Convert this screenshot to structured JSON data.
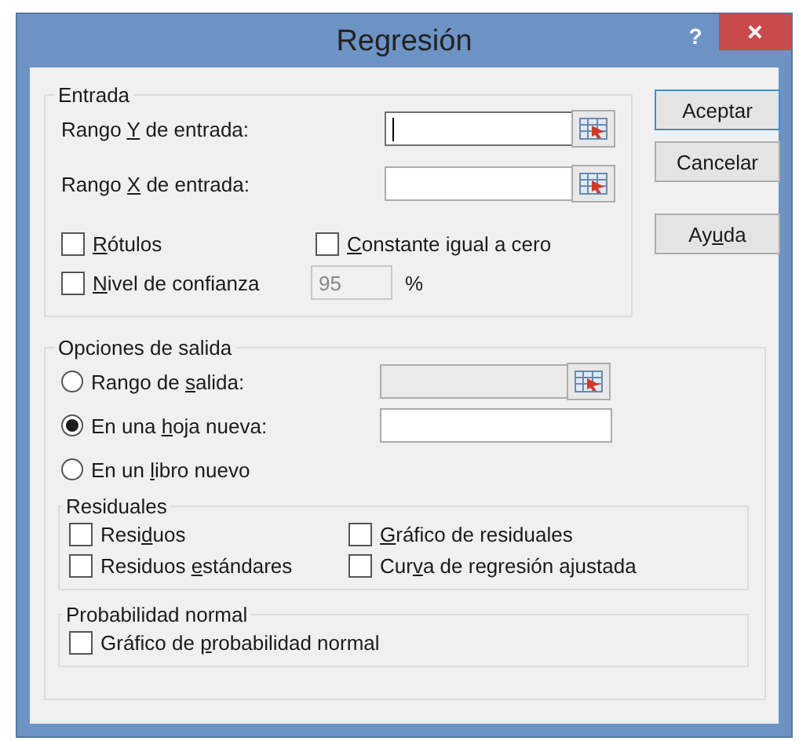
{
  "window": {
    "title": "Regresión",
    "help": "?",
    "close": "×"
  },
  "input": {
    "title": "Entrada",
    "ranges": [
      {
        "label": {
          "pre": "Rango ",
          "key": "Y",
          "post": " de entrada:"
        },
        "focused": true
      },
      {
        "label": {
          "pre": "Rango ",
          "key": "X",
          "post": " de entrada:"
        },
        "focused": false
      }
    ],
    "labels_check": {
      "label": {
        "key": "R",
        "post": "ótulos"
      },
      "checked": false
    },
    "constant_check": {
      "label": {
        "key": "C",
        "post": "onstante igual a cero"
      },
      "checked": false
    },
    "confidence": {
      "label": {
        "key": "N",
        "post": "ivel de confianza"
      },
      "checked": false,
      "value": "95",
      "disabled": true,
      "unit": "%"
    }
  },
  "output": {
    "title": "Opciones de salida",
    "options": [
      {
        "kind": "range",
        "label": {
          "pre": "Rango de ",
          "key": "s",
          "post": "alida:"
        },
        "selected": false,
        "field_disabled": true
      },
      {
        "kind": "sheet",
        "label": {
          "pre": "En una ",
          "key": "h",
          "post": "oja nueva:"
        },
        "selected": true,
        "field_disabled": false
      },
      {
        "kind": "book",
        "label": {
          "pre": "En un ",
          "key": "l",
          "post": "ibro nuevo"
        },
        "selected": false
      }
    ],
    "residuals": {
      "title": "Residuales",
      "checks": [
        {
          "label": {
            "pre": "Resi",
            "key": "d",
            "post": "uos"
          },
          "checked": false
        },
        {
          "label": {
            "key": "G",
            "post": "ráfico de residuales"
          },
          "checked": false
        },
        {
          "label": {
            "pre": "Residuos ",
            "key": "e",
            "post": "stándares"
          },
          "checked": false
        },
        {
          "label": {
            "pre": "Cur",
            "key": "v",
            "post": "a de regresión ajustada"
          },
          "checked": false
        }
      ]
    },
    "normal": {
      "title": "Probabilidad normal",
      "checks": [
        {
          "label": {
            "pre": "Gráfico de ",
            "key": "p",
            "post": "robabilidad normal"
          },
          "checked": false
        }
      ]
    }
  },
  "buttons": [
    {
      "label": {
        "pre": "Aceptar"
      },
      "default": true
    },
    {
      "label": {
        "pre": "Cancelar"
      },
      "default": false
    },
    {
      "label": {
        "pre": "Ay",
        "key": "u",
        "post": "da"
      },
      "default": false
    }
  ]
}
